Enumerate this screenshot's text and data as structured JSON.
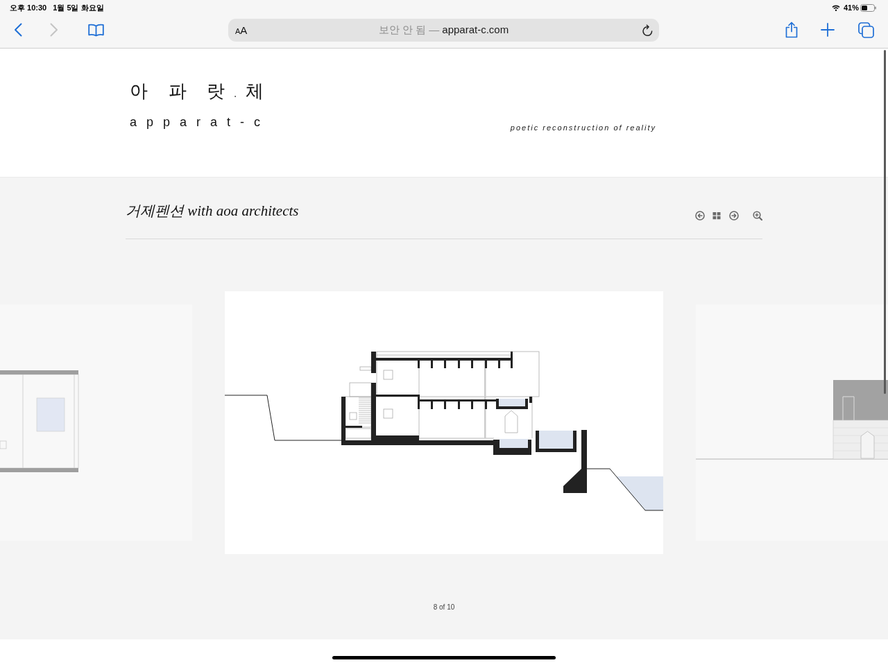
{
  "status_bar": {
    "time": "오후 10:30",
    "date": "1월 5일 화요일",
    "battery": "41%"
  },
  "toolbar": {
    "back": {
      "disabled": false
    },
    "forward": {
      "disabled": true
    },
    "address_bar": {
      "text_size": "AA",
      "security": "보안 안 됨 —",
      "domain": "apparat-c.com"
    }
  },
  "site_header": {
    "logo_korean": "아 파 랏.체",
    "logo_latin": "a p p a r a t - c",
    "tagline": "poetic reconstruction of reality"
  },
  "gallery": {
    "title": "거제펜션 with aoa architects",
    "slides": [
      {
        "kind": "plan",
        "selected": false
      },
      {
        "kind": "section",
        "selected": true
      },
      {
        "kind": "elevation",
        "selected": false
      }
    ],
    "counter": "8 of 10"
  }
}
